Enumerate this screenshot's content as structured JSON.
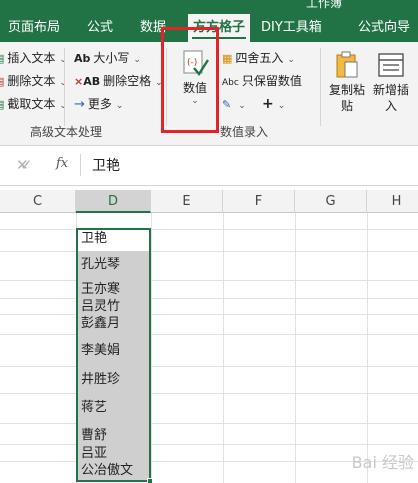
{
  "window": {
    "title": "工作簿"
  },
  "tabs": [
    {
      "label": "页面布局",
      "active": false
    },
    {
      "label": "公式",
      "active": false
    },
    {
      "label": "数据",
      "active": false
    },
    {
      "label": "方方格子",
      "active": true
    },
    {
      "label": "DIY工具箱",
      "active": false
    },
    {
      "label": "公式向导",
      "active": false
    }
  ],
  "ribbon": {
    "text_group": {
      "label": "高级文本处理",
      "insert_text": "插入文本",
      "delete_text": "删除文本",
      "extract_text": "截取文本",
      "case": "大小写",
      "delete_space": "删除空格",
      "more": "更多"
    },
    "value_group": {
      "label": "数值录入",
      "value_button": "数值",
      "round": "四舍五入",
      "keep_value": "只保留数值",
      "plus": "+"
    },
    "copy_paste": {
      "line1": "复制粘",
      "line2": "贴"
    },
    "new_insert": {
      "line1": "新增插",
      "line2": "入"
    }
  },
  "formula_bar": {
    "fx": "fx",
    "content": "卫艳"
  },
  "columns": [
    "C",
    "D",
    "E",
    "F",
    "G",
    "H"
  ],
  "selected_column": "D",
  "cells": {
    "header": "卫艳",
    "names": [
      "孔光琴",
      "王亦寒",
      "吕灵竹",
      "彭鑫月",
      "李美娟",
      "井胜珍",
      "蒋艺",
      "曹舒",
      "吕亚",
      "公冶傲文"
    ]
  },
  "icons": {
    "insert_text": "insert-text-icon",
    "delete_text": "delete-text-icon",
    "extract_text": "extract-text-icon",
    "case": "case-icon",
    "delete_space": "delete-space-icon",
    "more": "arrow-right-icon",
    "value": "value-check-icon",
    "round": "round-grid-icon",
    "keep_value": "abc-icon",
    "edit": "edit-icon",
    "plus": "plus-icon",
    "copy_paste": "clipboard-icon",
    "new_insert": "table-insert-icon"
  },
  "colors": {
    "excel_green": "#217346",
    "highlight_red": "#e0242a",
    "selection_fill": "#cfcfcf"
  },
  "watermark": "Bai 经验"
}
